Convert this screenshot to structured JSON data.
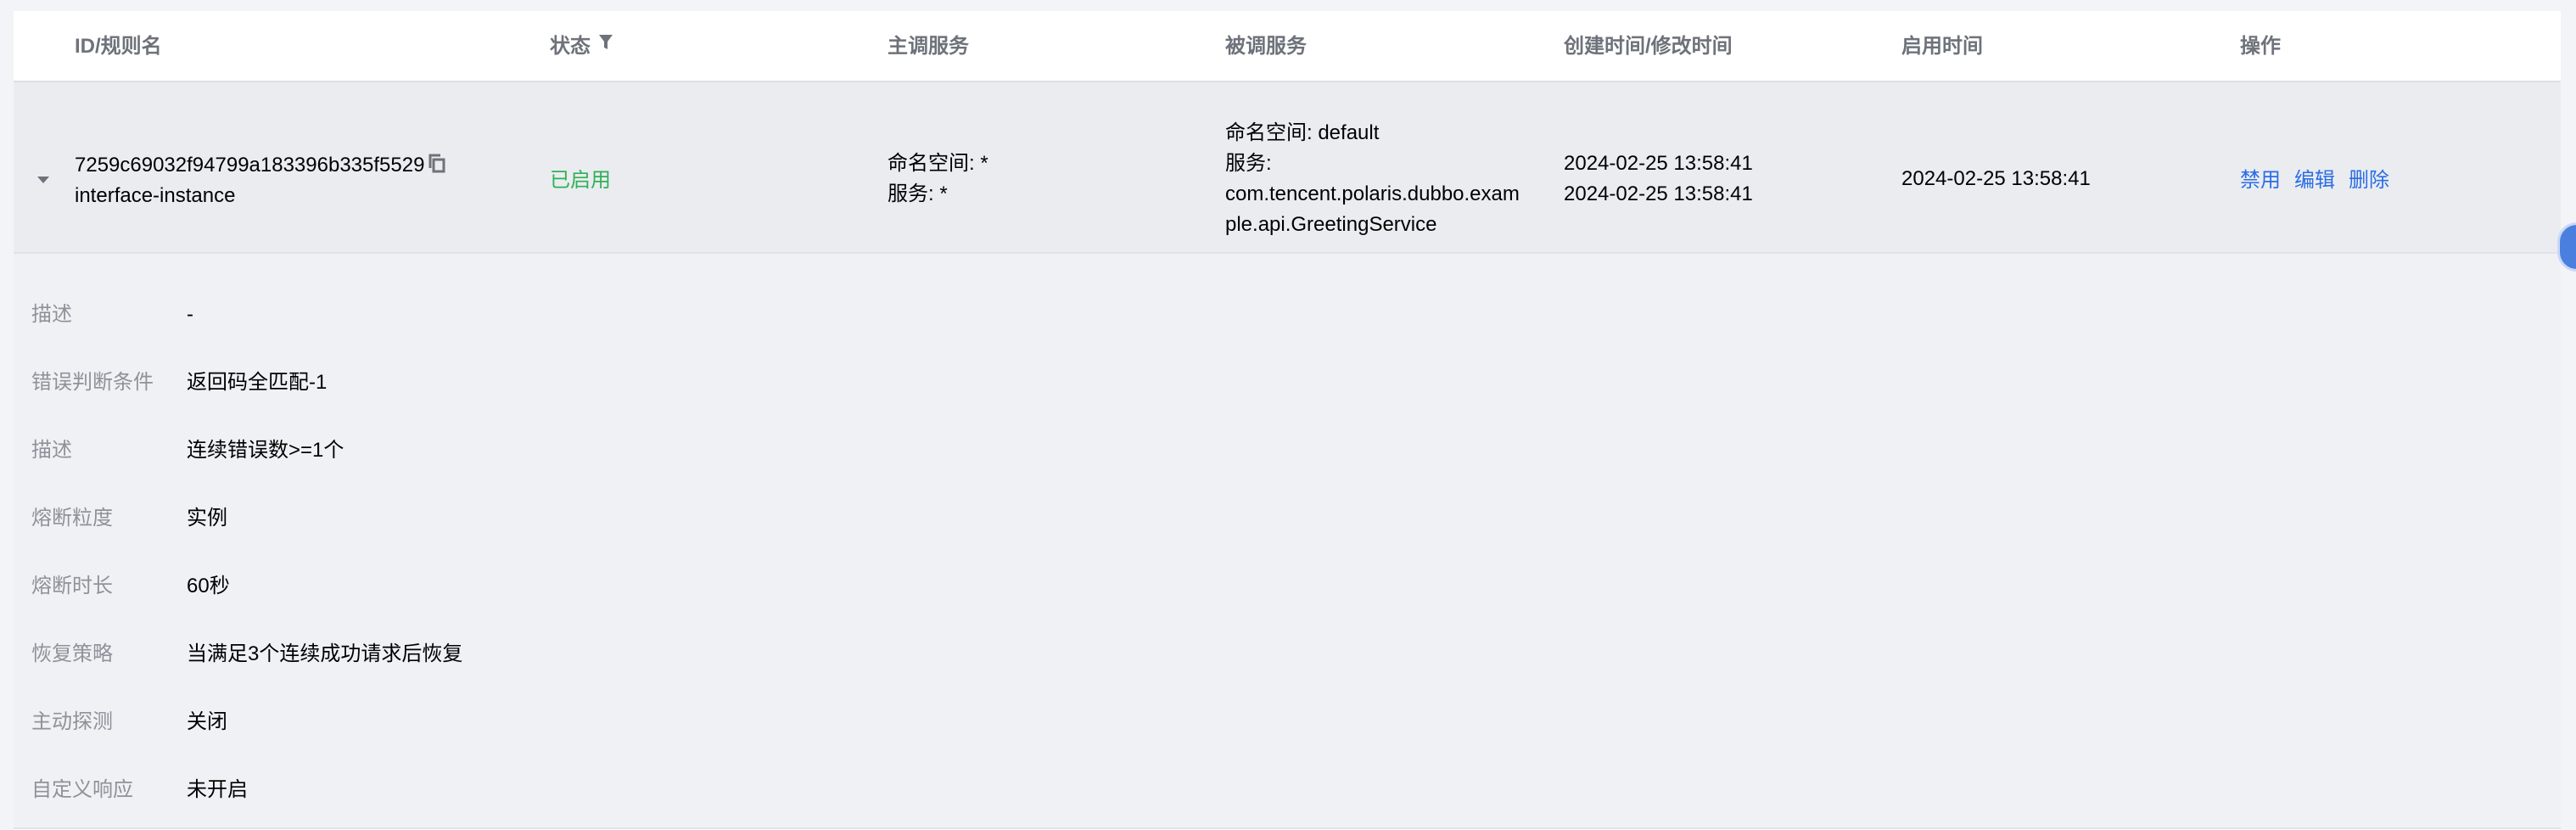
{
  "table": {
    "columns": {
      "id_rule": "ID/规则名",
      "status": "状态",
      "caller": "主调服务",
      "callee": "被调服务",
      "times": "创建时间/修改时间",
      "enabled_time": "启用时间",
      "actions": "操作"
    },
    "row": {
      "id": "7259c69032f94799a183396b335f5529",
      "rule_name": "interface-instance",
      "status": "已启用",
      "caller_namespace": "命名空间: *",
      "caller_service": "服务: *",
      "callee_namespace": "命名空间: default",
      "callee_service_label": "服务:",
      "callee_service_line1": "com.tencent.polaris.dubbo.exam",
      "callee_service_line2": "ple.api.GreetingService",
      "created_time": "2024-02-25 13:58:41",
      "modified_time": "2024-02-25 13:58:41",
      "enabled_time": "2024-02-25 13:58:41",
      "actions": {
        "disable": "禁用",
        "edit": "编辑",
        "delete": "删除"
      }
    }
  },
  "detail": [
    {
      "label": "描述",
      "value": "-"
    },
    {
      "label": "错误判断条件",
      "value": "返回码全匹配-1"
    },
    {
      "label": "描述",
      "value": "连续错误数>=1个"
    },
    {
      "label": "熔断粒度",
      "value": "实例"
    },
    {
      "label": "熔断时长",
      "value": "60秒"
    },
    {
      "label": "恢复策略",
      "value": "当满足3个连续成功请求后恢复"
    },
    {
      "label": "主动探测",
      "value": "关闭"
    },
    {
      "label": "自定义响应",
      "value": "未开启"
    }
  ],
  "colors": {
    "status_enabled": "#2fb155",
    "action_link": "#2b6de6",
    "row_bg": "#eaecf0",
    "detail_bg": "#f0f1f5"
  },
  "icons": [
    "filter-icon",
    "expand-arrow-icon",
    "copy-icon"
  ]
}
